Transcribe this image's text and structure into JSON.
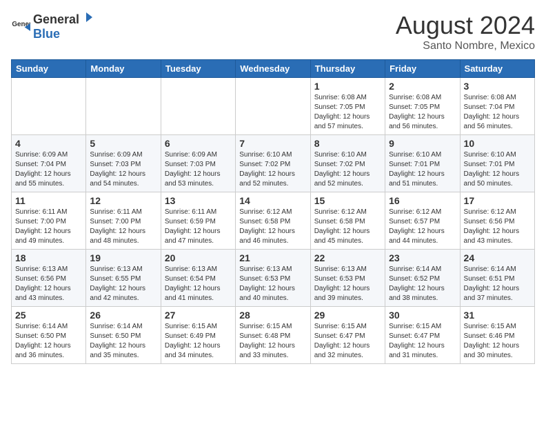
{
  "header": {
    "logo": {
      "general": "General",
      "blue": "Blue"
    },
    "title": "August 2024",
    "location": "Santo Nombre, Mexico"
  },
  "weekdays": [
    "Sunday",
    "Monday",
    "Tuesday",
    "Wednesday",
    "Thursday",
    "Friday",
    "Saturday"
  ],
  "weeks": [
    [
      {
        "day": "",
        "info": ""
      },
      {
        "day": "",
        "info": ""
      },
      {
        "day": "",
        "info": ""
      },
      {
        "day": "",
        "info": ""
      },
      {
        "day": "1",
        "info": "Sunrise: 6:08 AM\nSunset: 7:05 PM\nDaylight: 12 hours and 57 minutes."
      },
      {
        "day": "2",
        "info": "Sunrise: 6:08 AM\nSunset: 7:05 PM\nDaylight: 12 hours and 56 minutes."
      },
      {
        "day": "3",
        "info": "Sunrise: 6:08 AM\nSunset: 7:04 PM\nDaylight: 12 hours and 56 minutes."
      }
    ],
    [
      {
        "day": "4",
        "info": "Sunrise: 6:09 AM\nSunset: 7:04 PM\nDaylight: 12 hours and 55 minutes."
      },
      {
        "day": "5",
        "info": "Sunrise: 6:09 AM\nSunset: 7:03 PM\nDaylight: 12 hours and 54 minutes."
      },
      {
        "day": "6",
        "info": "Sunrise: 6:09 AM\nSunset: 7:03 PM\nDaylight: 12 hours and 53 minutes."
      },
      {
        "day": "7",
        "info": "Sunrise: 6:10 AM\nSunset: 7:02 PM\nDaylight: 12 hours and 52 minutes."
      },
      {
        "day": "8",
        "info": "Sunrise: 6:10 AM\nSunset: 7:02 PM\nDaylight: 12 hours and 52 minutes."
      },
      {
        "day": "9",
        "info": "Sunrise: 6:10 AM\nSunset: 7:01 PM\nDaylight: 12 hours and 51 minutes."
      },
      {
        "day": "10",
        "info": "Sunrise: 6:10 AM\nSunset: 7:01 PM\nDaylight: 12 hours and 50 minutes."
      }
    ],
    [
      {
        "day": "11",
        "info": "Sunrise: 6:11 AM\nSunset: 7:00 PM\nDaylight: 12 hours and 49 minutes."
      },
      {
        "day": "12",
        "info": "Sunrise: 6:11 AM\nSunset: 7:00 PM\nDaylight: 12 hours and 48 minutes."
      },
      {
        "day": "13",
        "info": "Sunrise: 6:11 AM\nSunset: 6:59 PM\nDaylight: 12 hours and 47 minutes."
      },
      {
        "day": "14",
        "info": "Sunrise: 6:12 AM\nSunset: 6:58 PM\nDaylight: 12 hours and 46 minutes."
      },
      {
        "day": "15",
        "info": "Sunrise: 6:12 AM\nSunset: 6:58 PM\nDaylight: 12 hours and 45 minutes."
      },
      {
        "day": "16",
        "info": "Sunrise: 6:12 AM\nSunset: 6:57 PM\nDaylight: 12 hours and 44 minutes."
      },
      {
        "day": "17",
        "info": "Sunrise: 6:12 AM\nSunset: 6:56 PM\nDaylight: 12 hours and 43 minutes."
      }
    ],
    [
      {
        "day": "18",
        "info": "Sunrise: 6:13 AM\nSunset: 6:56 PM\nDaylight: 12 hours and 43 minutes."
      },
      {
        "day": "19",
        "info": "Sunrise: 6:13 AM\nSunset: 6:55 PM\nDaylight: 12 hours and 42 minutes."
      },
      {
        "day": "20",
        "info": "Sunrise: 6:13 AM\nSunset: 6:54 PM\nDaylight: 12 hours and 41 minutes."
      },
      {
        "day": "21",
        "info": "Sunrise: 6:13 AM\nSunset: 6:53 PM\nDaylight: 12 hours and 40 minutes."
      },
      {
        "day": "22",
        "info": "Sunrise: 6:13 AM\nSunset: 6:53 PM\nDaylight: 12 hours and 39 minutes."
      },
      {
        "day": "23",
        "info": "Sunrise: 6:14 AM\nSunset: 6:52 PM\nDaylight: 12 hours and 38 minutes."
      },
      {
        "day": "24",
        "info": "Sunrise: 6:14 AM\nSunset: 6:51 PM\nDaylight: 12 hours and 37 minutes."
      }
    ],
    [
      {
        "day": "25",
        "info": "Sunrise: 6:14 AM\nSunset: 6:50 PM\nDaylight: 12 hours and 36 minutes."
      },
      {
        "day": "26",
        "info": "Sunrise: 6:14 AM\nSunset: 6:50 PM\nDaylight: 12 hours and 35 minutes."
      },
      {
        "day": "27",
        "info": "Sunrise: 6:15 AM\nSunset: 6:49 PM\nDaylight: 12 hours and 34 minutes."
      },
      {
        "day": "28",
        "info": "Sunrise: 6:15 AM\nSunset: 6:48 PM\nDaylight: 12 hours and 33 minutes."
      },
      {
        "day": "29",
        "info": "Sunrise: 6:15 AM\nSunset: 6:47 PM\nDaylight: 12 hours and 32 minutes."
      },
      {
        "day": "30",
        "info": "Sunrise: 6:15 AM\nSunset: 6:47 PM\nDaylight: 12 hours and 31 minutes."
      },
      {
        "day": "31",
        "info": "Sunrise: 6:15 AM\nSunset: 6:46 PM\nDaylight: 12 hours and 30 minutes."
      }
    ]
  ]
}
